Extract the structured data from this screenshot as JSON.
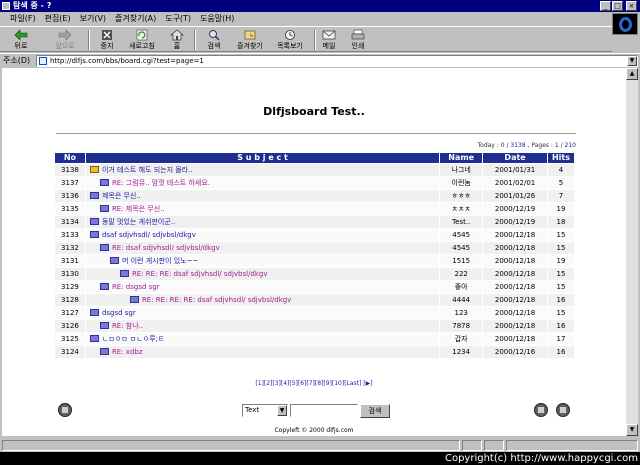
{
  "window": {
    "title": "탐색 중 - ?",
    "controls": [
      "_",
      "□",
      "×"
    ]
  },
  "menu": [
    "파일(F)",
    "편집(E)",
    "보기(V)",
    "즐겨찾기(A)",
    "도구(T)",
    "도움말(H)"
  ],
  "toolbar": [
    {
      "label": "뒤로",
      "icon": "back-arrow-icon",
      "disabled": false
    },
    {
      "label": "앞으로",
      "icon": "forward-arrow-icon",
      "disabled": true
    },
    {
      "label": "중지",
      "icon": "stop-icon",
      "disabled": false
    },
    {
      "label": "새로고침",
      "icon": "refresh-icon",
      "disabled": false
    },
    {
      "label": "홈",
      "icon": "home-icon",
      "disabled": false
    },
    {
      "label": "검색",
      "icon": "search-icon",
      "disabled": false
    },
    {
      "label": "즐겨찾기",
      "icon": "favorites-icon",
      "disabled": false
    },
    {
      "label": "목록보기",
      "icon": "history-icon",
      "disabled": false
    },
    {
      "label": "메일",
      "icon": "mail-icon",
      "disabled": false
    },
    {
      "label": "인쇄",
      "icon": "print-icon",
      "disabled": false
    }
  ],
  "address": {
    "label": "주소(D)",
    "url": "http://dlfjs.com/bbs/board.cgi?test=page=1"
  },
  "board": {
    "title": "Dlfjsboard Test..",
    "stats_prefix": "Today : ",
    "today": "0",
    "total": "3138",
    "pages_prefix": " , Pages : ",
    "page": "1",
    "pages": "210",
    "headers": {
      "no": "No",
      "subject": "S u b j e c t",
      "name": "Name",
      "date": "Date",
      "hits": "Hits"
    },
    "rows": [
      {
        "no": "3138",
        "depth": 0,
        "hot": true,
        "subject": "이거 테스트 해도 되는지 몰라..",
        "name": "나그네",
        "date": "2001/01/31",
        "hits": "4"
      },
      {
        "no": "3137",
        "depth": 1,
        "hot": false,
        "subject": "RE: 그럼뮤.. 맘껏 테스트 하세요.",
        "name": "이런놈",
        "date": "2001/02/01",
        "hits": "5"
      },
      {
        "no": "3136",
        "depth": 0,
        "hot": false,
        "subject": "제목은 무신..",
        "name": "ㅎㅎㅎ",
        "date": "2001/01/26",
        "hits": "7"
      },
      {
        "no": "3135",
        "depth": 1,
        "hot": false,
        "subject": "RE: 제목은 무신..",
        "name": "ㅊㅊㅊ",
        "date": "2000/12/19",
        "hits": "19"
      },
      {
        "no": "3134",
        "depth": 0,
        "hot": false,
        "subject": "동말 멋있는 게쉬판이군..",
        "name": "Test..",
        "date": "2000/12/19",
        "hits": "18"
      },
      {
        "no": "3133",
        "depth": 0,
        "hot": false,
        "subject": "dsaf sdjvhsdl/ sdjvbsl/dkgv",
        "name": "4545",
        "date": "2000/12/18",
        "hits": "15"
      },
      {
        "no": "3132",
        "depth": 1,
        "hot": false,
        "subject": "RE: dsaf sdjvhsdl/ sdjvbsl/dkgv",
        "name": "4545",
        "date": "2000/12/18",
        "hits": "15"
      },
      {
        "no": "3131",
        "depth": 2,
        "hot": false,
        "subject": "머 이런 게시판이 있노~~",
        "name": "1515",
        "date": "2000/12/18",
        "hits": "19"
      },
      {
        "no": "3130",
        "depth": 3,
        "hot": false,
        "subject": "RE: RE: RE: dsaf sdjvhsdl/ sdjvbsl/dkgv",
        "name": "222",
        "date": "2000/12/18",
        "hits": "15"
      },
      {
        "no": "3129",
        "depth": 1,
        "hot": false,
        "subject": "RE: dsgsd sgr",
        "name": "좋아",
        "date": "2000/12/18",
        "hits": "15"
      },
      {
        "no": "3128",
        "depth": 4,
        "hot": false,
        "subject": "RE: RE: RE: RE: dsaf sdjvhsdl/ sdjvbsl/dkgv",
        "name": "4444",
        "date": "2000/12/18",
        "hits": "16"
      },
      {
        "no": "3127",
        "depth": 0,
        "hot": false,
        "subject": "dsgsd sgr",
        "name": "123",
        "date": "2000/12/18",
        "hits": "15"
      },
      {
        "no": "3126",
        "depth": 1,
        "hot": false,
        "subject": "RE: 참나..",
        "name": "7878",
        "date": "2000/12/18",
        "hits": "16"
      },
      {
        "no": "3125",
        "depth": 0,
        "hot": false,
        "subject": "ㄴㅁㅇㅁ ㅁㄴㅇ루;ㅌ",
        "name": "갑자",
        "date": "2000/12/18",
        "hits": "17"
      },
      {
        "no": "3124",
        "depth": 1,
        "hot": false,
        "subject": "RE: xdbz",
        "name": "1234",
        "date": "2000/12/16",
        "hits": "16"
      }
    ],
    "pager": "[1][2][3][4][5][6][7][8][9][10][Last] [▶]",
    "search_field": "Text",
    "search_value": "",
    "search_button": "검색",
    "copyright": "Copyleft © 2000 dlfjs.com"
  },
  "watermark": "Copyright(c) http://www.happycgi.com"
}
